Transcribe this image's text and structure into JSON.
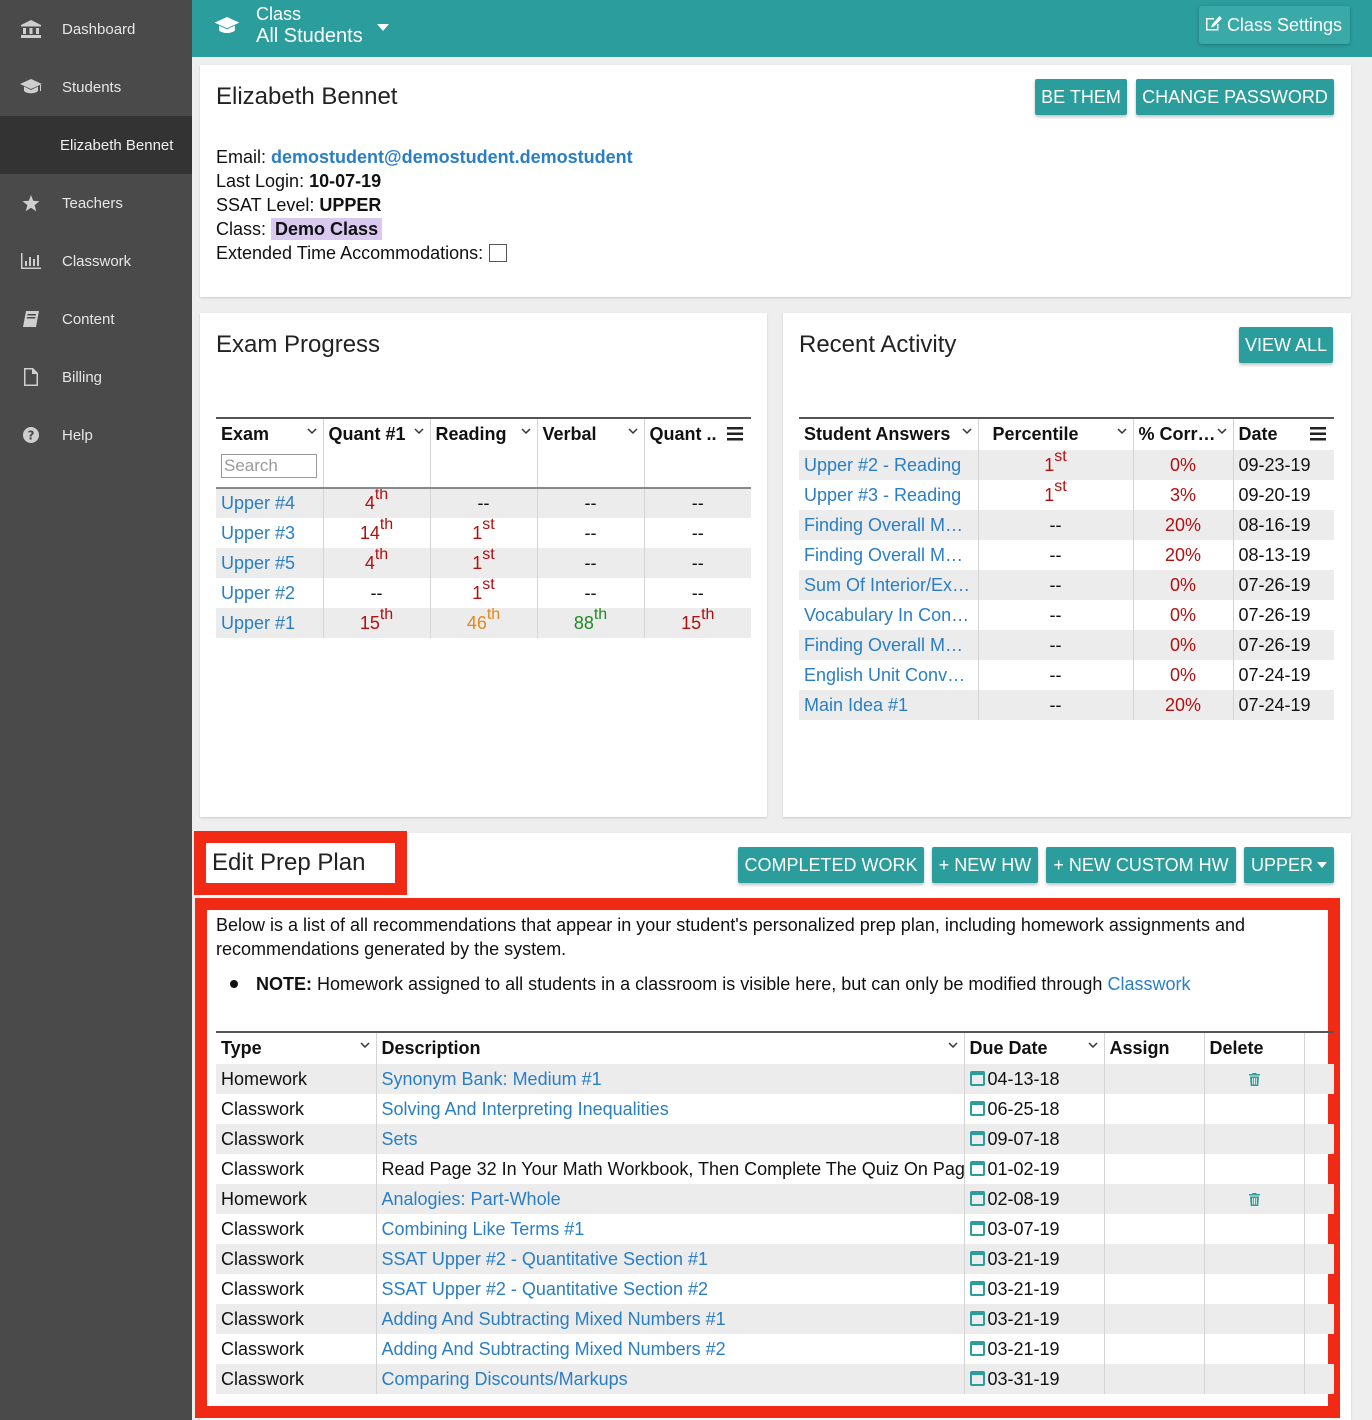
{
  "sidebar": {
    "items": [
      {
        "label": "Dashboard",
        "icon": "bank-icon"
      },
      {
        "label": "Students",
        "icon": "graduation-cap-icon"
      },
      {
        "label": "Elizabeth Bennet",
        "icon": ""
      },
      {
        "label": "Teachers",
        "icon": "star-icon"
      },
      {
        "label": "Classwork",
        "icon": "bar-chart-icon"
      },
      {
        "label": "Content",
        "icon": "book-icon"
      },
      {
        "label": "Billing",
        "icon": "file-icon"
      },
      {
        "label": "Help",
        "icon": "question-circle-icon"
      }
    ]
  },
  "topbar": {
    "class_label": "Class",
    "class_value": "All Students",
    "settings_label": "Class Settings"
  },
  "profile": {
    "name": "Elizabeth Bennet",
    "be_them": "BE THEM",
    "change_password": "CHANGE PASSWORD",
    "email_label": "Email:",
    "email": "demostudent@demostudent.demostudent",
    "last_login_label": "Last Login:",
    "last_login": "10-07-19",
    "ssat_label": "SSAT Level:",
    "ssat": "UPPER",
    "class_label": "Class:",
    "class": "Demo Class",
    "extended_label": "Extended Time Accommodations:"
  },
  "exam_progress": {
    "title": "Exam Progress",
    "headers": [
      "Exam",
      "Quant #1",
      "Reading",
      "Verbal",
      "Quant .."
    ],
    "search_placeholder": "Search",
    "rows": [
      {
        "exam": "Upper #4",
        "cells": [
          {
            "n": "4",
            "s": "th",
            "c": "red"
          },
          {
            "n": "--",
            "s": "",
            "c": ""
          },
          {
            "n": "--",
            "s": "",
            "c": ""
          },
          {
            "n": "--",
            "s": "",
            "c": ""
          }
        ]
      },
      {
        "exam": "Upper #3",
        "cells": [
          {
            "n": "14",
            "s": "th",
            "c": "red"
          },
          {
            "n": "1",
            "s": "st",
            "c": "red"
          },
          {
            "n": "--",
            "s": "",
            "c": ""
          },
          {
            "n": "--",
            "s": "",
            "c": ""
          }
        ]
      },
      {
        "exam": "Upper #5",
        "cells": [
          {
            "n": "4",
            "s": "th",
            "c": "red"
          },
          {
            "n": "1",
            "s": "st",
            "c": "red"
          },
          {
            "n": "--",
            "s": "",
            "c": ""
          },
          {
            "n": "--",
            "s": "",
            "c": ""
          }
        ]
      },
      {
        "exam": "Upper #2",
        "cells": [
          {
            "n": "--",
            "s": "",
            "c": ""
          },
          {
            "n": "1",
            "s": "st",
            "c": "red"
          },
          {
            "n": "--",
            "s": "",
            "c": ""
          },
          {
            "n": "--",
            "s": "",
            "c": ""
          }
        ]
      },
      {
        "exam": "Upper #1",
        "cells": [
          {
            "n": "15",
            "s": "th",
            "c": "red"
          },
          {
            "n": "46",
            "s": "th",
            "c": "orange"
          },
          {
            "n": "88",
            "s": "th",
            "c": "green"
          },
          {
            "n": "15",
            "s": "th",
            "c": "red"
          }
        ]
      }
    ]
  },
  "recent_activity": {
    "title": "Recent Activity",
    "view_all": "VIEW ALL",
    "headers": [
      "Student Answers",
      "Percentile",
      "% Corr…",
      "Date"
    ],
    "rows": [
      {
        "answer": "Upper #2 - Reading",
        "pct_n": "1",
        "pct_s": "st",
        "correct": "0%",
        "date": "09-23-19"
      },
      {
        "answer": "Upper #3 - Reading",
        "pct_n": "1",
        "pct_s": "st",
        "correct": "3%",
        "date": "09-20-19"
      },
      {
        "answer": "Finding Overall M…",
        "pct_n": "--",
        "pct_s": "",
        "correct": "20%",
        "date": "08-16-19"
      },
      {
        "answer": "Finding Overall M…",
        "pct_n": "--",
        "pct_s": "",
        "correct": "20%",
        "date": "08-13-19"
      },
      {
        "answer": "Sum Of Interior/Ex…",
        "pct_n": "--",
        "pct_s": "",
        "correct": "0%",
        "date": "07-26-19"
      },
      {
        "answer": "Vocabulary In Con…",
        "pct_n": "--",
        "pct_s": "",
        "correct": "0%",
        "date": "07-26-19"
      },
      {
        "answer": "Finding Overall M…",
        "pct_n": "--",
        "pct_s": "",
        "correct": "0%",
        "date": "07-26-19"
      },
      {
        "answer": "English Unit Conv…",
        "pct_n": "--",
        "pct_s": "",
        "correct": "0%",
        "date": "07-24-19"
      },
      {
        "answer": "Main Idea #1",
        "pct_n": "--",
        "pct_s": "",
        "correct": "20%",
        "date": "07-24-19"
      }
    ]
  },
  "prep_plan": {
    "title": "Edit Prep Plan",
    "buttons": [
      "COMPLETED WORK",
      "+ NEW HW",
      "+ NEW CUSTOM HW",
      "UPPER"
    ],
    "intro": "Below is a list of all recommendations that appear in your student's personalized prep plan, including homework assignments and recommendations generated by the system.",
    "note_label": "NOTE:",
    "note_text": "Homework assigned to all students in a classroom is visible here, but can only be modified through",
    "note_link": "Classwork",
    "headers": [
      "Type",
      "Description",
      "Due Date",
      "Assign",
      "Delete"
    ],
    "rows": [
      {
        "type": "Homework",
        "desc": "Synonym Bank: Medium #1",
        "link": true,
        "due": "04-13-18",
        "del": true
      },
      {
        "type": "Classwork",
        "desc": "Solving And Interpreting Inequalities",
        "link": true,
        "due": "06-25-18",
        "del": false
      },
      {
        "type": "Classwork",
        "desc": "Sets",
        "link": true,
        "due": "09-07-18",
        "del": false
      },
      {
        "type": "Classwork",
        "desc": "Read Page 32 In Your Math Workbook, Then Complete The Quiz On Pag",
        "link": false,
        "due": "01-02-19",
        "del": false
      },
      {
        "type": "Homework",
        "desc": "Analogies: Part-Whole",
        "link": true,
        "due": "02-08-19",
        "del": true
      },
      {
        "type": "Classwork",
        "desc": "Combining Like Terms #1",
        "link": true,
        "due": "03-07-19",
        "del": false
      },
      {
        "type": "Classwork",
        "desc": "SSAT Upper #2 - Quantitative Section #1",
        "link": true,
        "due": "03-21-19",
        "del": false
      },
      {
        "type": "Classwork",
        "desc": "SSAT Upper #2 - Quantitative Section #2",
        "link": true,
        "due": "03-21-19",
        "del": false
      },
      {
        "type": "Classwork",
        "desc": "Adding And Subtracting Mixed Numbers #1",
        "link": true,
        "due": "03-21-19",
        "del": false
      },
      {
        "type": "Classwork",
        "desc": "Adding And Subtracting Mixed Numbers #2",
        "link": true,
        "due": "03-21-19",
        "del": false
      },
      {
        "type": "Classwork",
        "desc": "Comparing Discounts/Markups",
        "link": true,
        "due": "03-31-19",
        "del": false
      }
    ]
  },
  "colors": {
    "accent": "#2a9d9c",
    "highlight": "#f02a14",
    "sidebar": "#4a4a4a"
  }
}
